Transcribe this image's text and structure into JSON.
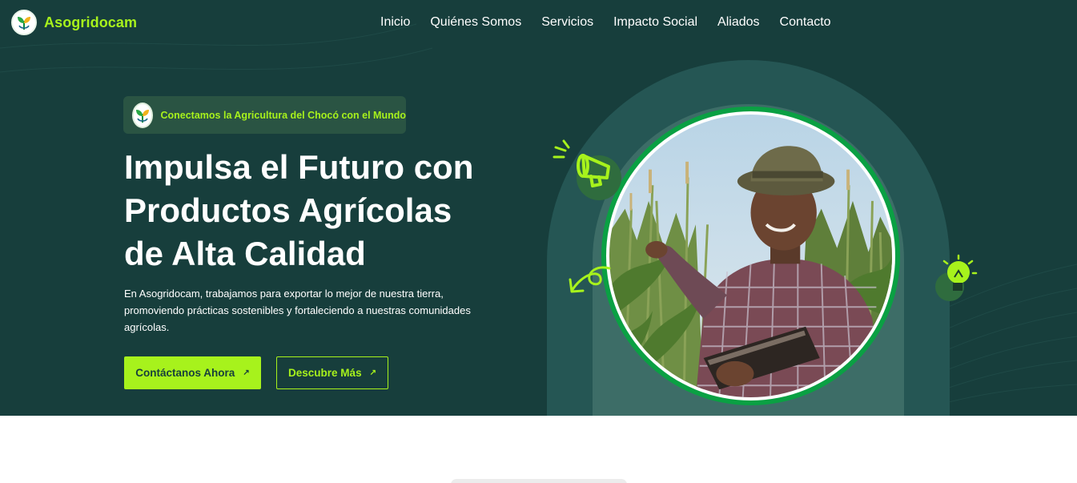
{
  "brand": {
    "name": "Asogridocam",
    "logo_icon": "leaf-sprout-icon"
  },
  "nav": {
    "items": [
      {
        "label": "Inicio"
      },
      {
        "label": "Quiénes Somos"
      },
      {
        "label": "Servicios"
      },
      {
        "label": "Impacto Social"
      },
      {
        "label": "Aliados"
      },
      {
        "label": "Contacto"
      }
    ]
  },
  "hero": {
    "badge": "Conectamos la Agricultura del Chocó con el Mundo",
    "headline_lines": [
      "Impulsa el Futuro con",
      "Productos Agrícolas",
      "de Alta Calidad"
    ],
    "description": "En Asogridocam, trabajamos para exportar lo mejor de nuestra tierra, promoviendo prácticas sostenibles y fortaleciendo a nuestras comunidades agrícolas.",
    "primary_button": "Contáctanos Ahora",
    "secondary_button": "Descubre Más",
    "button_arrow": "↗",
    "image_subject": "farmer-in-cornfield",
    "decorations": [
      "megaphone-icon",
      "curved-arrow-icon",
      "lightbulb-icon"
    ]
  },
  "colors": {
    "hero_background": "#173e3c",
    "accent": "#a7f21c",
    "ring": "#0aa043",
    "text": "#ffffff"
  }
}
